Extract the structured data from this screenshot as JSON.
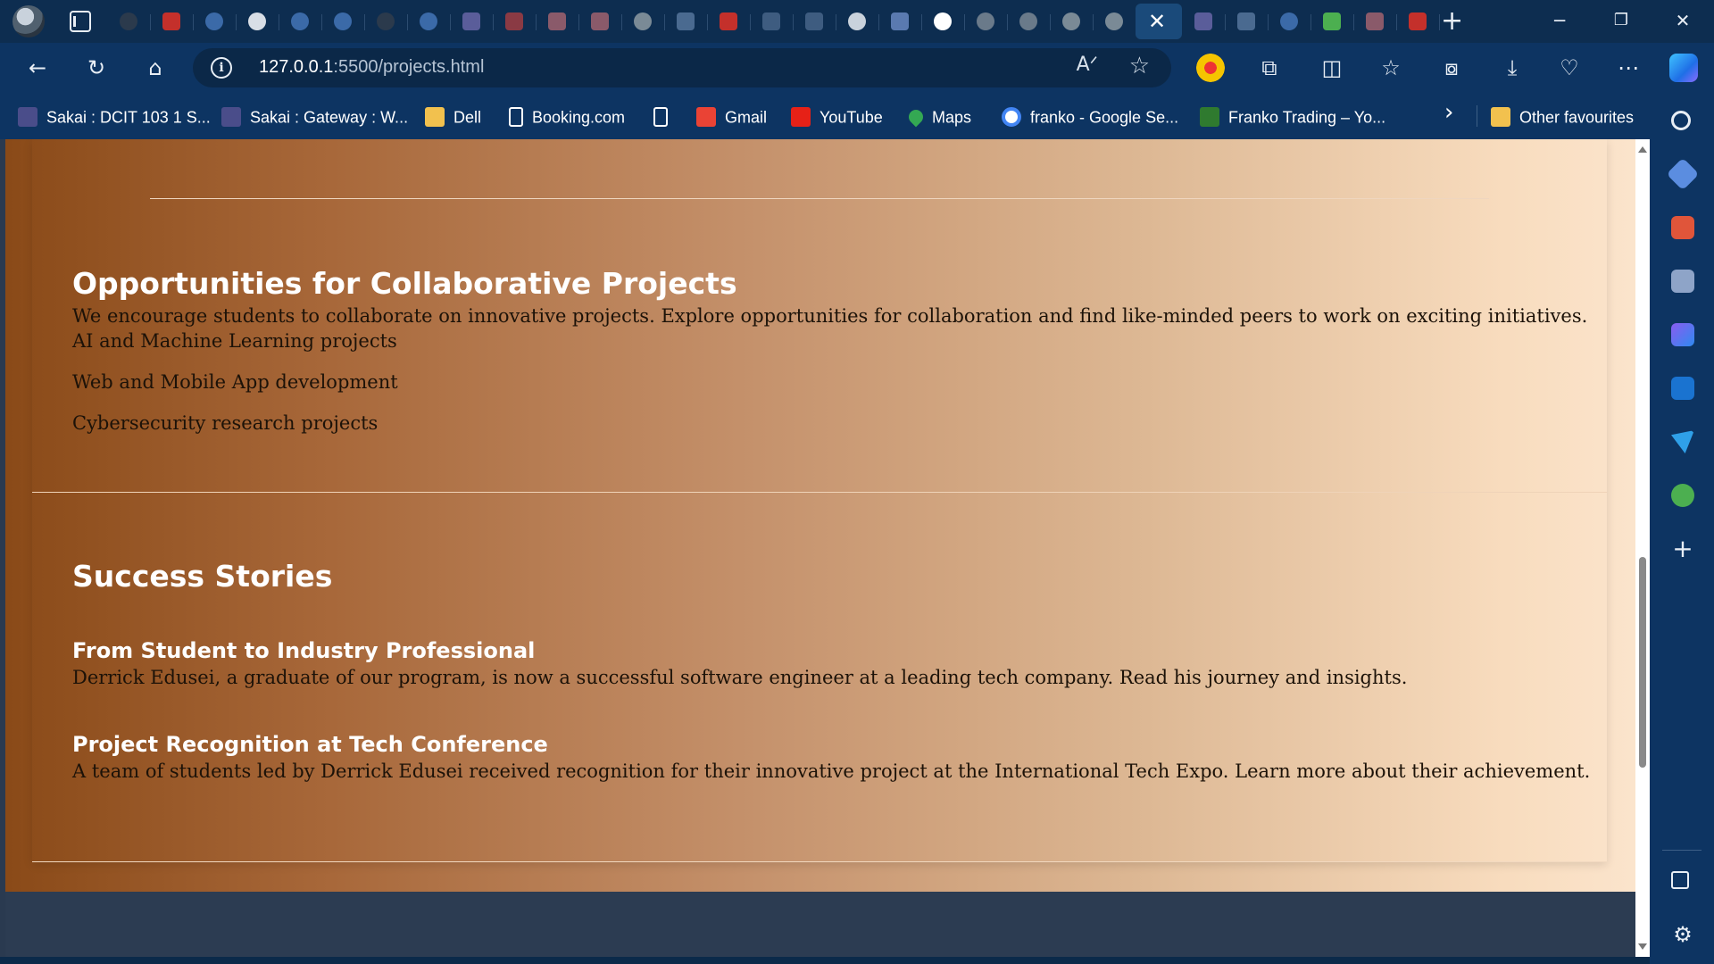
{
  "browser": {
    "url_host": "127.0.0.1",
    "url_rest": ":5500/projects.html",
    "tab_close_glyph": "✕",
    "new_tab_glyph": "+",
    "window_controls": {
      "minimize": "─",
      "restore": "❐",
      "close": "✕"
    }
  },
  "tabs": [
    {
      "icon": "github-icon",
      "color": "#2b3a4c"
    },
    {
      "icon": "youtube-icon",
      "color": "#c4302b"
    },
    {
      "icon": "search-icon",
      "color": "#3b6aa8"
    },
    {
      "icon": "github-icon",
      "color": "#d8dee6"
    },
    {
      "icon": "search-icon",
      "color": "#3b6aa8"
    },
    {
      "icon": "search-icon",
      "color": "#3b6aa8"
    },
    {
      "icon": "github-icon",
      "color": "#2b3a4c"
    },
    {
      "icon": "search-icon",
      "color": "#3b6aa8"
    },
    {
      "icon": "sakai-icon",
      "color": "#5a5d9a"
    },
    {
      "icon": "youtube-icon",
      "color": "#8a3a44"
    },
    {
      "icon": "pdf-icon",
      "color": "#8a5a6a"
    },
    {
      "icon": "pdf-icon",
      "color": "#8a5a6a"
    },
    {
      "icon": "chatgpt-icon",
      "color": "#7a8a96"
    },
    {
      "icon": "more-icon",
      "color": "#4a6a90"
    },
    {
      "icon": "youtube-icon",
      "color": "#c4302b"
    },
    {
      "icon": "document-icon",
      "color": "#3e5c80"
    },
    {
      "icon": "flag-icon",
      "color": "#3e5c80"
    },
    {
      "icon": "github-icon",
      "color": "#c9d2dc"
    },
    {
      "icon": "notes-icon",
      "color": "#5a7ab0"
    },
    {
      "icon": "github-icon",
      "color": "#ffffff"
    },
    {
      "icon": "github-icon",
      "color": "#6a7a8a"
    },
    {
      "icon": "github-icon",
      "color": "#6a7a8a"
    },
    {
      "icon": "chatgpt-icon",
      "color": "#7a8a96"
    },
    {
      "icon": "chatgpt-icon",
      "color": "#7a8a96"
    },
    {
      "icon": "close-icon",
      "color": "#1a4a7a",
      "active": true
    },
    {
      "icon": "sakai-icon",
      "color": "#5a5d9a"
    },
    {
      "icon": "more-icon",
      "color": "#4a6a90"
    },
    {
      "icon": "search-icon",
      "color": "#3b6aa8"
    },
    {
      "icon": "maps-icon",
      "color": "#4caf50"
    },
    {
      "icon": "pdf-icon",
      "color": "#8a5a6a"
    },
    {
      "icon": "youtube-icon",
      "color": "#c4302b"
    }
  ],
  "bookmarks": [
    {
      "label": "Sakai : DCIT 103 1 S...",
      "icon": "sakai-icon",
      "color": "#4a4d8a"
    },
    {
      "label": "Sakai : Gateway : W...",
      "icon": "sakai-icon",
      "color": "#4a4d8a"
    },
    {
      "label": "Dell",
      "icon": "folder-icon",
      "color": "#f2c14e"
    },
    {
      "label": "Booking.com",
      "icon": "document-icon",
      "color": "#0d3462"
    },
    {
      "label": "",
      "icon": "document-icon",
      "color": "#0d3462"
    },
    {
      "label": "Gmail",
      "icon": "gmail-icon",
      "color": "#ea4335"
    },
    {
      "label": "YouTube",
      "icon": "youtube-icon",
      "color": "#e62117"
    },
    {
      "label": "Maps",
      "icon": "maps-icon",
      "color": "#34a853"
    },
    {
      "label": "franko - Google Se...",
      "icon": "google-icon",
      "color": "#ffffff"
    },
    {
      "label": "Franko Trading – Yo...",
      "icon": "franko-icon",
      "color": "#2f7a2f"
    }
  ],
  "bookmarks_more_glyph": "›",
  "bookmarks_other": "Other favourites",
  "content": {
    "collab_title": "Opportunities for Collaborative Projects",
    "collab_intro": "We encourage students to collaborate on innovative projects. Explore opportunities for collaboration and find like-minded peers to work on exciting initiatives.",
    "collab_items": [
      "AI and Machine Learning projects",
      "Web and Mobile App development",
      "Cybersecurity research projects"
    ],
    "success_title": "Success Stories",
    "stories": [
      {
        "title": "From Student to Industry Professional",
        "text": "Derrick Edusei, a graduate of our program, is now a successful software engineer at a leading tech company. Read his journey and insights."
      },
      {
        "title": "Project Recognition at Tech Conference",
        "text": "A team of students led by Derrick Edusei received recognition for their innovative project at the International Tech Expo. Learn more about their achievement."
      }
    ]
  },
  "sidebar_icons": [
    "search-icon",
    "shopping-tag-icon",
    "toolbox-icon",
    "chess-icon",
    "copilot-icon",
    "outlook-icon",
    "send-icon",
    "tree-icon",
    "add-icon",
    "split-view-icon",
    "settings-icon"
  ]
}
